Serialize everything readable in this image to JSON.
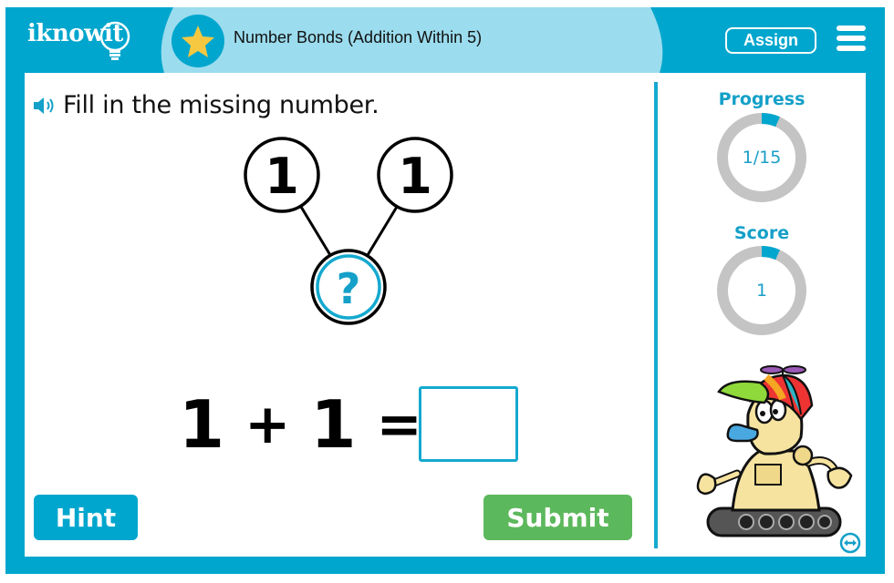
{
  "header": {
    "logo_text": "iknowit",
    "lesson_title": "Number Bonds (Addition Within 5)",
    "assign_label": "Assign",
    "menu_icon": "hamburger-menu-icon",
    "badge_icon": "star-icon"
  },
  "question": {
    "speaker_icon": "speaker-icon",
    "instruction": "Fill in the missing number.",
    "bond": {
      "part_left": "1",
      "part_right": "1",
      "whole": "?"
    },
    "equation": {
      "left_operand": "1",
      "operator": "+",
      "right_operand": "1",
      "equals": "=",
      "answer_value": "",
      "answer_placeholder": ""
    }
  },
  "buttons": {
    "hint_label": "Hint",
    "submit_label": "Submit"
  },
  "sidebar": {
    "progress": {
      "label": "Progress",
      "current": 1,
      "total": 15,
      "display": "1/15",
      "fraction": 0.0667
    },
    "score": {
      "label": "Score",
      "display": "1",
      "fraction": 0.0667
    },
    "mascot": "robot-mascot",
    "swap_icon": "swap-horizontal-icon"
  },
  "colors": {
    "brand_teal": "#00a6cd",
    "title_pill": "#9bdcee",
    "star": "#f6c842",
    "submit_green": "#5cb85c",
    "ring_track": "#c4c4c4",
    "ring_fill": "#00a6cd"
  }
}
